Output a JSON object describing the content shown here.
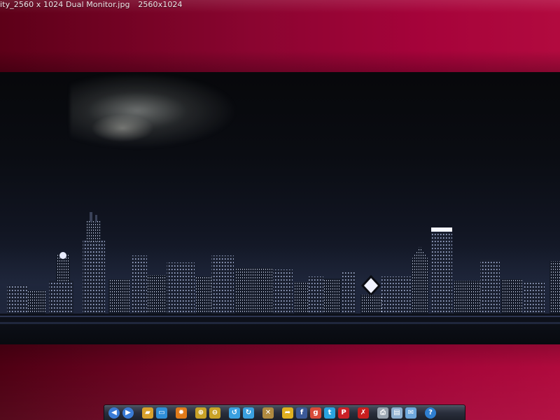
{
  "window": {
    "title": "ity_2560 x 1024 Dual Monitor.jpg",
    "dimensions": "2560x1024"
  },
  "colors": {
    "band": "#9a0333",
    "toolbar": "#2a2f3c"
  },
  "image": {
    "subject": "city-skyline-at-night"
  },
  "toolbar": {
    "buttons": [
      {
        "name": "prev-button",
        "icon": "arrow-left-icon",
        "glyph": "◀",
        "color": "#3a7bd5"
      },
      {
        "name": "next-button",
        "icon": "arrow-right-icon",
        "glyph": "▶",
        "color": "#3a7bd5"
      },
      {
        "name": "open-folder-button",
        "icon": "folder-icon",
        "glyph": "▰",
        "color": "#d8a12c"
      },
      {
        "name": "fullscreen-button",
        "icon": "monitor-icon",
        "glyph": "▭",
        "color": "#2f8fd8"
      },
      {
        "name": "settings-button",
        "icon": "gear-icon",
        "glyph": "✹",
        "color": "#e07a1a"
      },
      {
        "name": "zoom-in-button",
        "icon": "zoom-in-icon",
        "glyph": "⊕",
        "color": "#c9a227"
      },
      {
        "name": "zoom-out-button",
        "icon": "zoom-out-icon",
        "glyph": "⊖",
        "color": "#c9a227"
      },
      {
        "name": "rotate-left-button",
        "icon": "rotate-left-icon",
        "glyph": "↺",
        "color": "#3aa0e0"
      },
      {
        "name": "rotate-right-button",
        "icon": "rotate-right-icon",
        "glyph": "↻",
        "color": "#3aa0e0"
      },
      {
        "name": "tools-button",
        "icon": "tools-icon",
        "glyph": "✕",
        "color": "#b08a40"
      },
      {
        "name": "share-button",
        "icon": "share-icon",
        "glyph": "➦",
        "color": "#e0b020"
      },
      {
        "name": "facebook-button",
        "icon": "facebook-icon",
        "glyph": "f",
        "color": "#3b5998"
      },
      {
        "name": "google-plus-button",
        "icon": "google-plus-icon",
        "glyph": "g",
        "color": "#d84a38"
      },
      {
        "name": "twitter-button",
        "icon": "twitter-icon",
        "glyph": "t",
        "color": "#2aa3e0"
      },
      {
        "name": "pinterest-button",
        "icon": "pinterest-icon",
        "glyph": "P",
        "color": "#cb2027"
      },
      {
        "name": "delete-button",
        "icon": "delete-icon",
        "glyph": "✗",
        "color": "#c81e1e"
      },
      {
        "name": "print-button",
        "icon": "printer-icon",
        "glyph": "⎙",
        "color": "#9aa4b0"
      },
      {
        "name": "save-button",
        "icon": "save-icon",
        "glyph": "▤",
        "color": "#8fb0d0"
      },
      {
        "name": "email-button",
        "icon": "email-icon",
        "glyph": "✉",
        "color": "#6fa8dc"
      },
      {
        "name": "help-button",
        "icon": "help-icon",
        "glyph": "?",
        "color": "#2f7fd0"
      }
    ]
  }
}
